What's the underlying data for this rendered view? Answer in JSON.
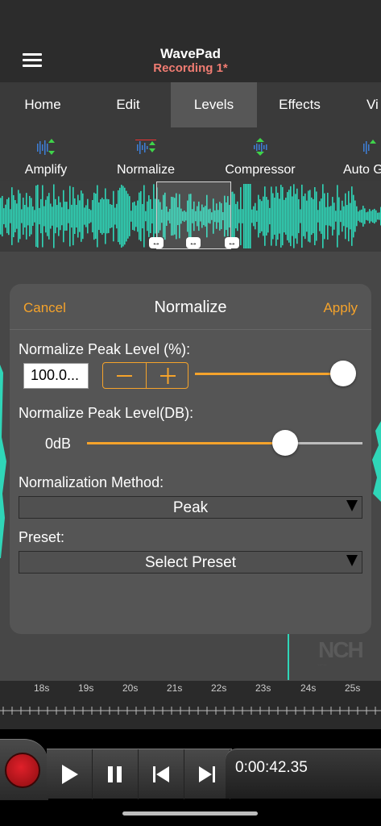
{
  "header": {
    "app_title": "WavePad",
    "file_name": "Recording 1*"
  },
  "tabs": [
    {
      "label": "Home"
    },
    {
      "label": "Edit"
    },
    {
      "label": "Levels",
      "active": true
    },
    {
      "label": "Effects"
    },
    {
      "label": "Vi"
    }
  ],
  "toolbar": {
    "items": [
      {
        "label": "Amplify",
        "icon": "amplify-icon"
      },
      {
        "label": "Normalize",
        "icon": "normalize-icon"
      },
      {
        "label": "Compressor",
        "icon": "compressor-icon"
      },
      {
        "label": "Auto G",
        "icon": "auto-gain-icon"
      }
    ]
  },
  "dialog": {
    "cancel_label": "Cancel",
    "title": "Normalize",
    "apply_label": "Apply",
    "peak_level_label": "Normalize Peak Level (%):",
    "peak_level_value": "100.0...",
    "peak_level_fraction": 1.0,
    "peak_db_label": "Normalize Peak Level(DB):",
    "peak_db_value": "0dB",
    "peak_db_fraction": 0.72,
    "method_label": "Normalization Method:",
    "method_value": "Peak",
    "preset_label": "Preset:",
    "preset_value": "Select Preset"
  },
  "timeline": {
    "labels": [
      "18s",
      "19s",
      "20s",
      "21s",
      "22s",
      "23s",
      "24s",
      "25s"
    ]
  },
  "transport": {
    "time": "0:00:42.35"
  },
  "colors": {
    "accent": "#f5a32b",
    "waveform": "#2fd6b8",
    "file_name": "#f07c72",
    "record": "#d0181f"
  },
  "watermark": "NCH"
}
